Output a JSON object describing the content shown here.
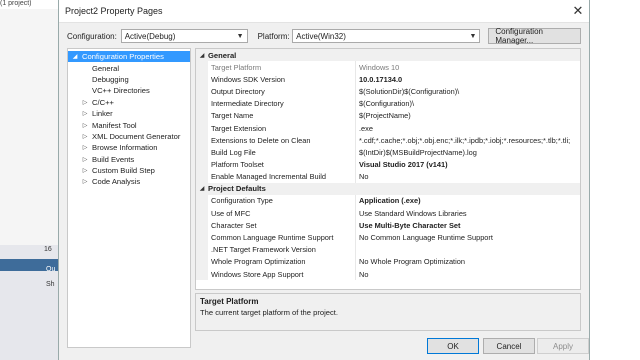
{
  "ide": {
    "top_text": "(1 project)",
    "num": "16",
    "label1": "Ou",
    "label2": "Sh"
  },
  "dialog": {
    "title": "Project2 Property Pages",
    "close_glyph": "✕",
    "configuration_label": "Configuration:",
    "configuration_value": "Active(Debug)",
    "platform_label": "Platform:",
    "platform_value": "Active(Win32)",
    "config_manager_label": "Configuration Manager..."
  },
  "tree": [
    {
      "label": "Configuration Properties",
      "indent": 0,
      "toggle": "◢",
      "selected": true
    },
    {
      "label": "General",
      "indent": 1,
      "toggle": ""
    },
    {
      "label": "Debugging",
      "indent": 1,
      "toggle": ""
    },
    {
      "label": "VC++ Directories",
      "indent": 1,
      "toggle": ""
    },
    {
      "label": "C/C++",
      "indent": 1,
      "toggle": "▷"
    },
    {
      "label": "Linker",
      "indent": 1,
      "toggle": "▷"
    },
    {
      "label": "Manifest Tool",
      "indent": 1,
      "toggle": "▷"
    },
    {
      "label": "XML Document Generator",
      "indent": 1,
      "toggle": "▷"
    },
    {
      "label": "Browse Information",
      "indent": 1,
      "toggle": "▷"
    },
    {
      "label": "Build Events",
      "indent": 1,
      "toggle": "▷"
    },
    {
      "label": "Custom Build Step",
      "indent": 1,
      "toggle": "▷"
    },
    {
      "label": "Code Analysis",
      "indent": 1,
      "toggle": "▷"
    }
  ],
  "grid": {
    "general": {
      "title": "General",
      "rows": [
        {
          "name": "Target Platform",
          "value": "Windows 10",
          "dim": true
        },
        {
          "name": "Windows SDK Version",
          "value": "10.0.17134.0",
          "bold": true
        },
        {
          "name": "Output Directory",
          "value": "$(SolutionDir)$(Configuration)\\"
        },
        {
          "name": "Intermediate Directory",
          "value": "$(Configuration)\\"
        },
        {
          "name": "Target Name",
          "value": "$(ProjectName)"
        },
        {
          "name": "Target Extension",
          "value": ".exe"
        },
        {
          "name": "Extensions to Delete on Clean",
          "value": "*.cdf;*.cache;*.obj;*.obj.enc;*.ilk;*.ipdb;*.iobj;*.resources;*.tlb;*.tli;"
        },
        {
          "name": "Build Log File",
          "value": "$(IntDir)$(MSBuildProjectName).log"
        },
        {
          "name": "Platform Toolset",
          "value": "Visual Studio 2017 (v141)",
          "bold": true
        },
        {
          "name": "Enable Managed Incremental Build",
          "value": "No"
        }
      ]
    },
    "defaults": {
      "title": "Project Defaults",
      "rows": [
        {
          "name": "Configuration Type",
          "value": "Application (.exe)",
          "bold": true
        },
        {
          "name": "Use of MFC",
          "value": "Use Standard Windows Libraries"
        },
        {
          "name": "Character Set",
          "value": "Use Multi-Byte Character Set",
          "bold": true
        },
        {
          "name": "Common Language Runtime Support",
          "value": "No Common Language Runtime Support"
        },
        {
          "name": ".NET Target Framework Version",
          "value": ""
        },
        {
          "name": "Whole Program Optimization",
          "value": "No Whole Program Optimization"
        },
        {
          "name": "Windows Store App Support",
          "value": "No"
        }
      ]
    }
  },
  "description": {
    "title": "Target Platform",
    "text": "The current target platform of the project."
  },
  "buttons": {
    "ok": "OK",
    "cancel": "Cancel",
    "apply": "Apply"
  }
}
